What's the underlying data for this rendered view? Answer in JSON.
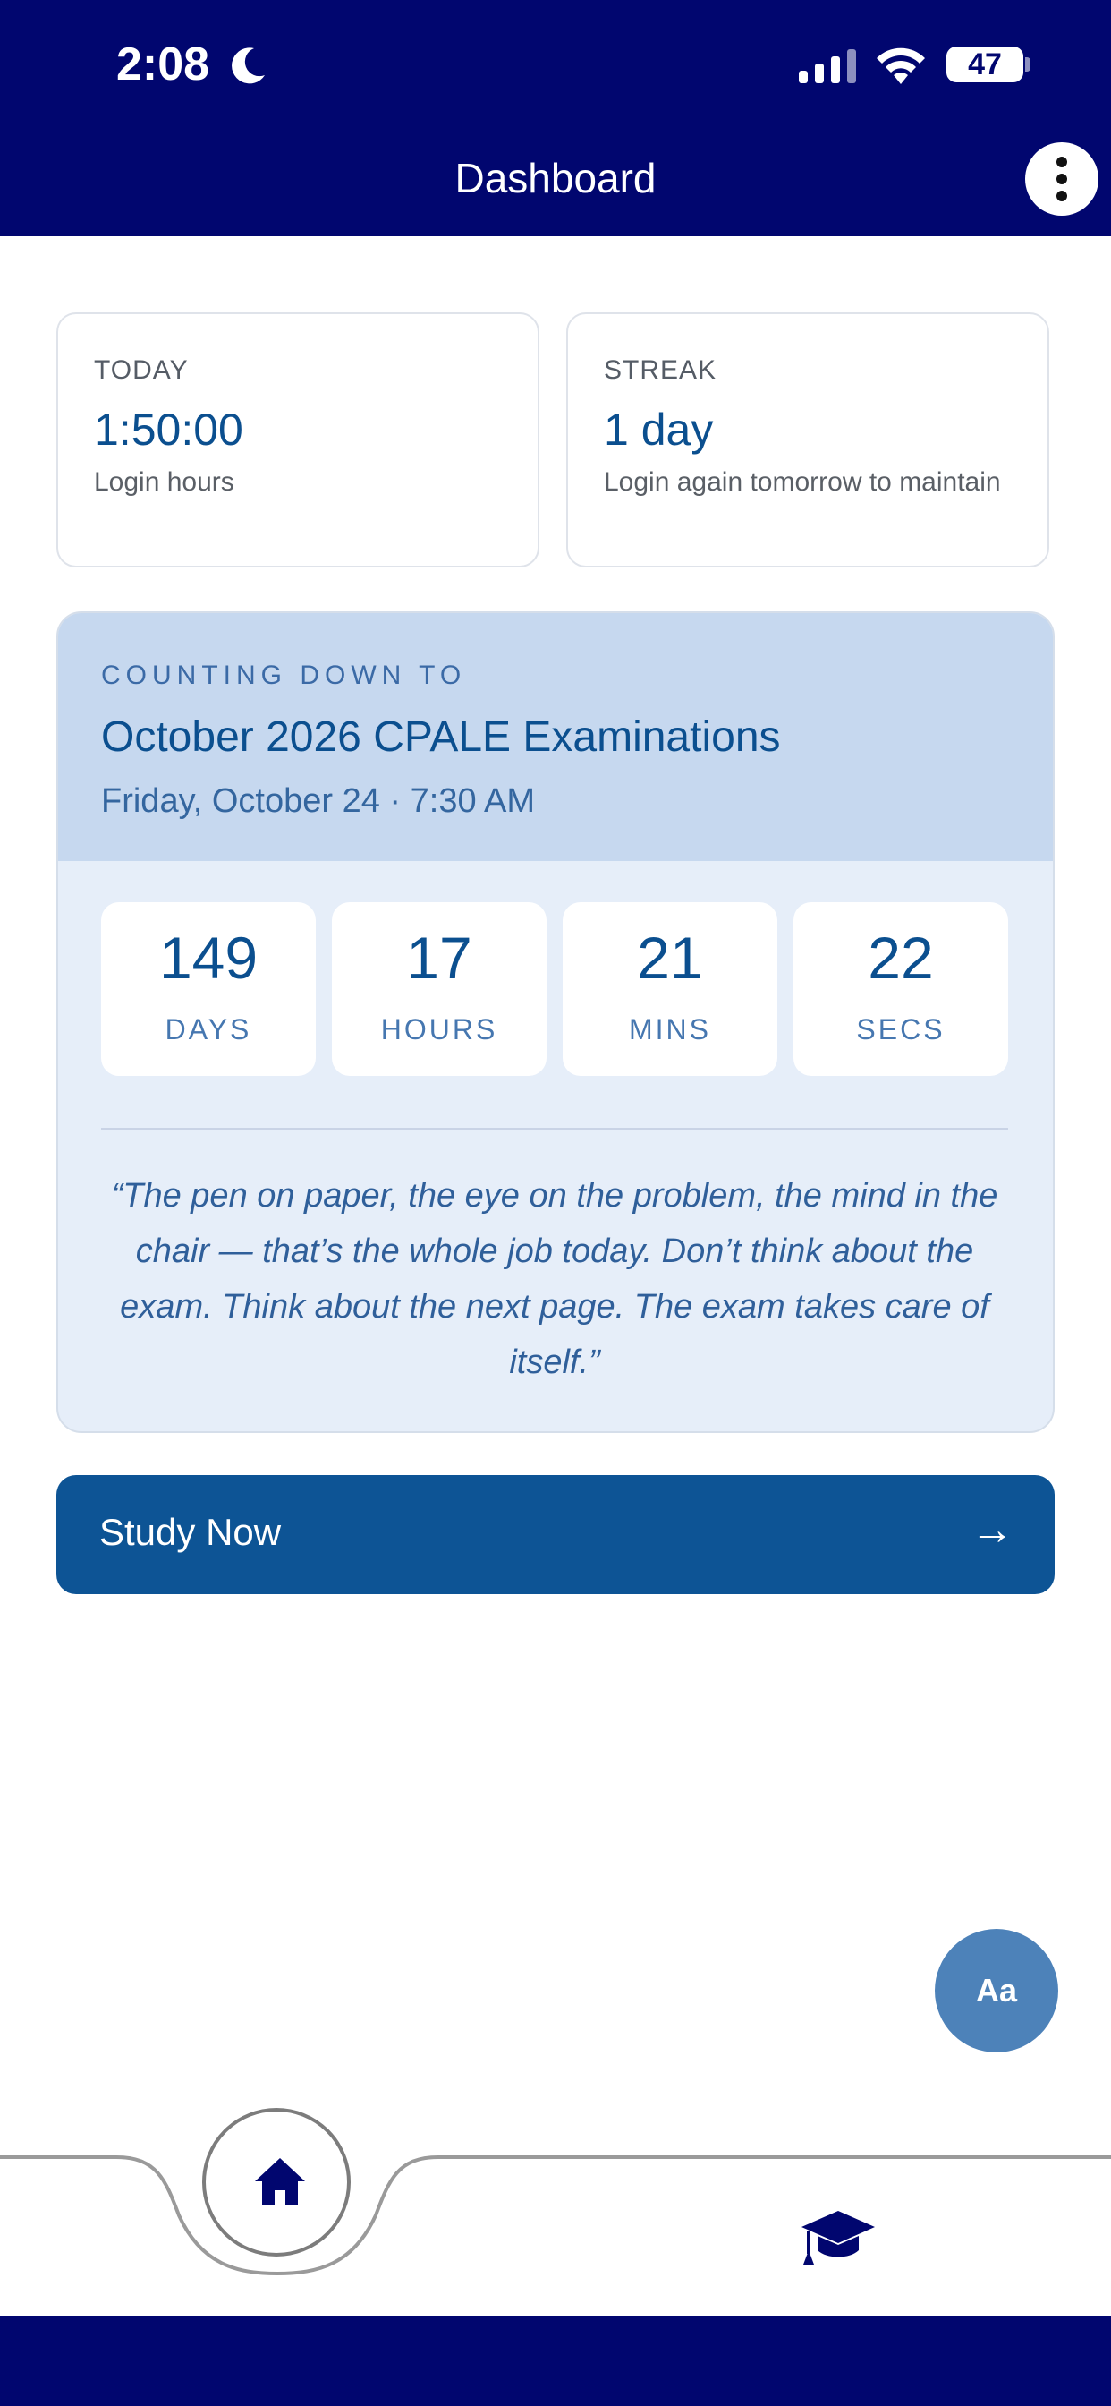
{
  "status_bar": {
    "time": "2:08",
    "battery": "47",
    "icons": [
      "moon-icon",
      "signal-icon",
      "wifi-icon",
      "battery-icon"
    ]
  },
  "header": {
    "title": "Dashboard",
    "menu_icon": "more-vertical-icon"
  },
  "stats": {
    "today": {
      "label": "TODAY",
      "value": "1:50:00",
      "sub": "Login hours"
    },
    "streak": {
      "label": "STREAK",
      "value": "1 day",
      "sub": "Login again tomorrow to maintain"
    }
  },
  "countdown": {
    "kicker": "COUNTING DOWN TO",
    "title": "October 2026 CPALE Examinations",
    "date": "Friday, October 24 · 7:30 AM",
    "units": [
      {
        "value": "149",
        "label": "DAYS"
      },
      {
        "value": "17",
        "label": "HOURS"
      },
      {
        "value": "21",
        "label": "MINS"
      },
      {
        "value": "22",
        "label": "SECS"
      }
    ],
    "quote": "“The pen on paper, the eye on the problem, the mind in the chair — that’s the whole job today. Don’t think about the exam. Think about the next page. The exam takes care of itself.”"
  },
  "study_button": {
    "label": "Study Now",
    "arrow": "→"
  },
  "font_button": {
    "label": "Aa"
  },
  "bottom_nav": {
    "items": [
      {
        "icon": "home-icon",
        "active": true
      },
      {
        "icon": "graduation-cap-icon",
        "active": false
      }
    ]
  },
  "colors": {
    "header_bg": "#01066f",
    "accent": "#0d5495",
    "countdown_head": "#c6d8ef",
    "countdown_body": "#e6eef9",
    "fab": "#4d82b9"
  }
}
